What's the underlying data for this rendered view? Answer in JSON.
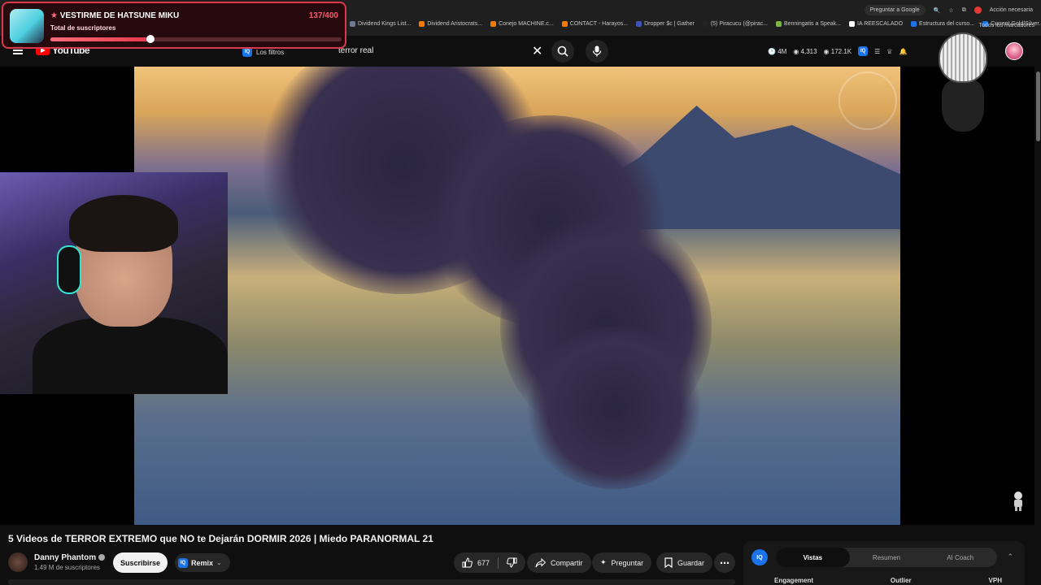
{
  "overlay": {
    "title": "VESTIRME DE HATSUNE MIKU",
    "count": "137/400",
    "label": "Total de suscriptores",
    "progress": 0.3425
  },
  "browser": {
    "bookmarks": [
      {
        "label": "Dividend Kings List...",
        "color": "#6b7a8f"
      },
      {
        "label": "Dividend Aristocrats...",
        "color": "#f57c00"
      },
      {
        "label": "Conejo MACHINE.c...",
        "color": "#f57c00"
      },
      {
        "label": "CONTACT - Harayos...",
        "color": "#f57c00"
      },
      {
        "label": "Dropper $c | Gather",
        "color": "#3f51b5"
      },
      {
        "label": "(5) Piracucu (@pirac...",
        "color": "#222222"
      },
      {
        "label": "Benningatis a Speak...",
        "color": "#7cb342"
      },
      {
        "label": "IA REESCALADO",
        "color": "#ffffff"
      },
      {
        "label": "Estructura del curso...",
        "color": "#1a73e8"
      },
      {
        "label": "Current Gold/Silver...",
        "color": "#1a73e8"
      }
    ],
    "ask_google": "Preguntar a Google",
    "action_needed": "Acción necesaria",
    "all_bookmarks": "Todos los marcadores"
  },
  "header": {
    "logo": "YouTube",
    "filters": "Los filtros",
    "search_query": "terror real",
    "stats": {
      "subs": "4M",
      "views": "4,313",
      "watching": "172.1K"
    }
  },
  "video": {
    "title": "5 Videos de TERROR EXTREMO que NO te Dejarán DORMIR 2026 | Miedo PARANORMAL 21",
    "channel": "Danny Phantom",
    "subscribers": "1.49 M de suscriptores",
    "subscribe": "Suscribirse",
    "remix": "Remix",
    "likes": "677",
    "share": "Compartir",
    "ask": "Preguntar",
    "save": "Guardar"
  },
  "side_panel": {
    "logo": "IQ",
    "tabs": [
      "Vistas",
      "Resumen",
      "AI Coach"
    ],
    "columns": [
      "Engagement",
      "Outlier",
      "VPH"
    ]
  }
}
